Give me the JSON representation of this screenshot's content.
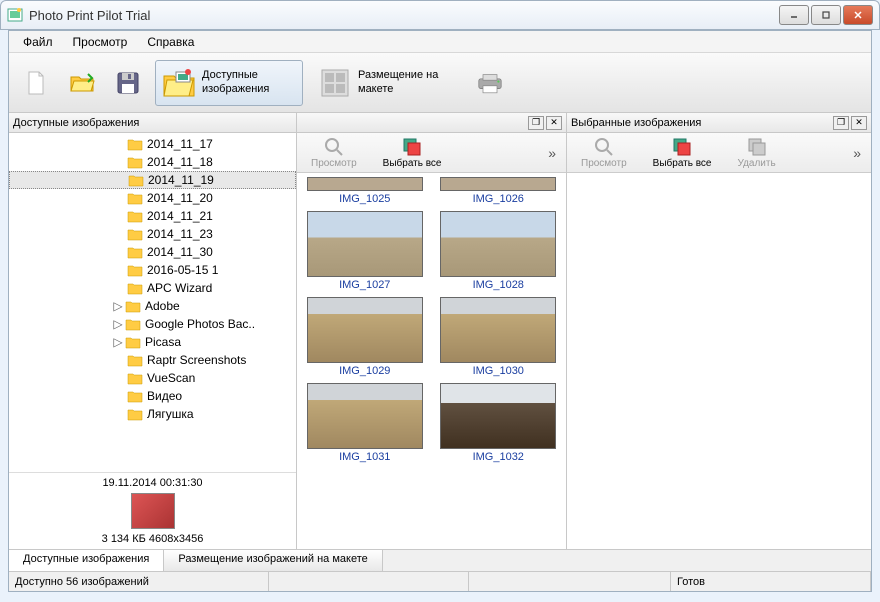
{
  "window": {
    "title": "Photo Print Pilot Trial"
  },
  "menu": {
    "file": "Файл",
    "view": "Просмотр",
    "help": "Справка"
  },
  "toolbar": {
    "available_images": "Доступные изображения",
    "layout_placement": "Размещение на макете"
  },
  "panels": {
    "available": {
      "title": "Доступные изображения",
      "toolbar": {
        "preview": "Просмотр",
        "select_all": "Выбрать все"
      }
    },
    "selected": {
      "title": "Выбранные изображения",
      "toolbar": {
        "preview": "Просмотр",
        "select_all": "Выбрать все",
        "delete": "Удалить"
      }
    }
  },
  "tree": {
    "items": [
      {
        "label": "2014_11_17",
        "expandable": false
      },
      {
        "label": "2014_11_18",
        "expandable": false
      },
      {
        "label": "2014_11_19",
        "expandable": false,
        "selected": true
      },
      {
        "label": "2014_11_20",
        "expandable": false
      },
      {
        "label": "2014_11_21",
        "expandable": false
      },
      {
        "label": "2014_11_23",
        "expandable": false
      },
      {
        "label": "2014_11_30",
        "expandable": false
      },
      {
        "label": "2016-05-15 1",
        "expandable": false
      },
      {
        "label": "APC Wizard",
        "expandable": false
      },
      {
        "label": "Adobe",
        "expandable": true
      },
      {
        "label": "Google Photos Bac..",
        "expandable": true
      },
      {
        "label": "Picasa",
        "expandable": true
      },
      {
        "label": "Raptr Screenshots",
        "expandable": false
      },
      {
        "label": "VueScan",
        "expandable": false
      },
      {
        "label": "Видео",
        "expandable": false
      },
      {
        "label": "Лягушка",
        "expandable": false
      }
    ],
    "info": {
      "datetime": "19.11.2014 00:31:30",
      "size_resolution": "3 134 КБ 4608x3456"
    }
  },
  "thumbs": [
    {
      "label": "IMG_1025",
      "partial": true
    },
    {
      "label": "IMG_1026",
      "partial": true
    },
    {
      "label": "IMG_1027",
      "style": "sky"
    },
    {
      "label": "IMG_1028",
      "style": "sky"
    },
    {
      "label": "IMG_1029",
      "style": "wall"
    },
    {
      "label": "IMG_1030",
      "style": "wall"
    },
    {
      "label": "IMG_1031",
      "style": "wall"
    },
    {
      "label": "IMG_1032",
      "style": "dark"
    }
  ],
  "bottom_tabs": {
    "available": "Доступные изображения",
    "placement": "Размещение изображений на макете"
  },
  "status": {
    "available_count": "Доступно 56 изображений",
    "ready": "Готов"
  }
}
